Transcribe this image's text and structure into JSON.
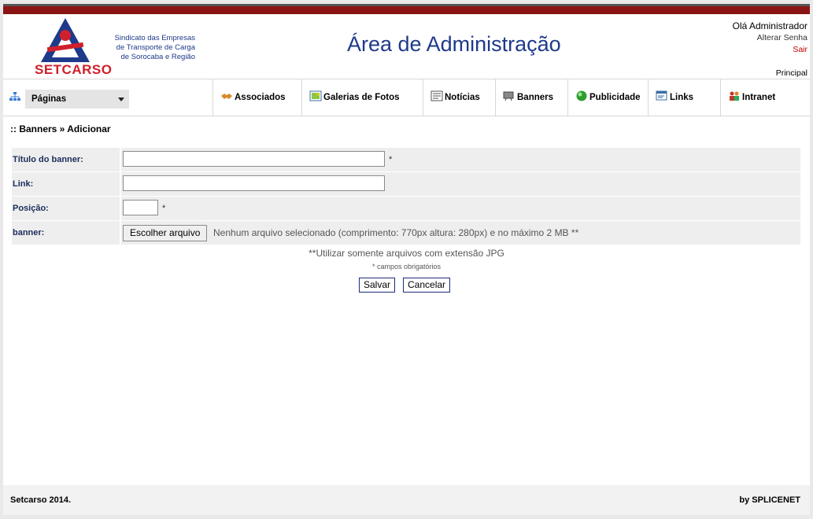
{
  "header": {
    "brand": "SETCARSO",
    "brand_subtitle": "Sindicato das Empresas de Transporte de Carga de Sorocaba e Região",
    "page_title": "Área de Administração",
    "greeting": "Olá Administrador",
    "change_password": "Alterar Senha",
    "logout": "Sair",
    "principal": "Principal"
  },
  "nav": {
    "pages_select": "Páginas",
    "items": [
      {
        "label": "Associados",
        "icon": "handshake-icon"
      },
      {
        "label": "Galerias de Fotos",
        "icon": "photo-gallery-icon"
      },
      {
        "label": "Notícias",
        "icon": "news-icon"
      },
      {
        "label": "Banners",
        "icon": "banner-icon"
      },
      {
        "label": "Publicidade",
        "icon": "green-orb-icon"
      },
      {
        "label": "Links",
        "icon": "links-icon"
      },
      {
        "label": "Intranet",
        "icon": "users-icon"
      }
    ]
  },
  "breadcrumb": ":: Banners » Adicionar",
  "form": {
    "title_label": "Título do banner:",
    "title_value": "",
    "link_label": "Link:",
    "link_value": "",
    "position_label": "Posição:",
    "position_value": "",
    "banner_label": "banner:",
    "file_button": "Escolher arquivo",
    "file_note": "Nenhum arquivo selecionado  (comprimento: 770px altura: 280px) e no máximo 2 MB **",
    "required_mark": "*",
    "jpg_note": "**Utilizar somente arquivos com extensão JPG",
    "required_note": "* campos obrigatórios",
    "save": "Salvar",
    "cancel": "Cancelar"
  },
  "footer": {
    "left": "Setcarso 2014.",
    "right": "by SPLICENET"
  },
  "colors": {
    "accent_red": "#8b1414",
    "title_blue": "#1e3a8a",
    "brand_red": "#d0202b"
  }
}
